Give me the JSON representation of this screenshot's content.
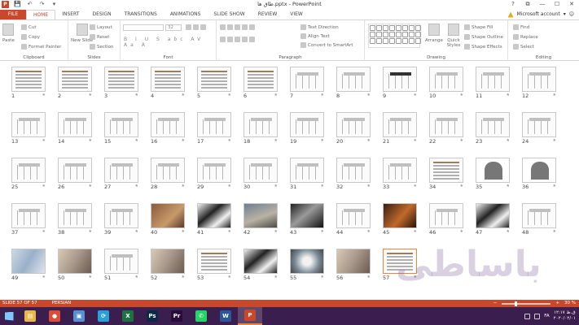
{
  "window": {
    "title": "طاق ها.pptx - PowerPoint",
    "help_glyph": "?",
    "controls": [
      "⧉",
      "—",
      "☐",
      "✕"
    ]
  },
  "qat": {
    "app_letter": "P",
    "save": "💾",
    "undo": "↶",
    "redo": "↷",
    "customize": "▾"
  },
  "tabs": [
    "FILE",
    "HOME",
    "INSERT",
    "DESIGN",
    "TRANSITIONS",
    "ANIMATIONS",
    "SLIDE SHOW",
    "REVIEW",
    "VIEW"
  ],
  "active_tab": "HOME",
  "account": {
    "label": "Microsoft account",
    "caret": "▾",
    "smiley": "☺"
  },
  "ribbon": {
    "clipboard": {
      "label": "Clipboard",
      "paste": "Paste",
      "cut": "Cut",
      "copy": "Copy",
      "format_painter": "Format Painter"
    },
    "slides": {
      "label": "Slides",
      "new_slide": "New Slide",
      "layout": "Layout",
      "reset": "Reset",
      "section": "Section"
    },
    "font": {
      "label": "Font",
      "size": "32",
      "formats": "B I U S abc AV Aa A"
    },
    "paragraph": {
      "label": "Paragraph",
      "text_direction": "Text Direction",
      "align_text": "Align Text",
      "smartart": "Convert to SmartArt"
    },
    "drawing": {
      "label": "Drawing",
      "arrange": "Arrange",
      "quick_styles": "Quick Styles",
      "shape_fill": "Shape Fill",
      "shape_outline": "Shape Outline",
      "shape_effects": "Shape Effects"
    },
    "editing": {
      "label": "Editing",
      "find": "Find",
      "replace": "Replace",
      "select": "Select"
    }
  },
  "slides": [
    {
      "n": "1",
      "kind": "text"
    },
    {
      "n": "2",
      "kind": "text"
    },
    {
      "n": "3",
      "kind": "text"
    },
    {
      "n": "4",
      "kind": "text"
    },
    {
      "n": "5",
      "kind": "text"
    },
    {
      "n": "6",
      "kind": "text"
    },
    {
      "n": "7",
      "kind": "drawing"
    },
    {
      "n": "8",
      "kind": "drawing"
    },
    {
      "n": "9",
      "kind": "drawing-dark"
    },
    {
      "n": "10",
      "kind": "drawing"
    },
    {
      "n": "11",
      "kind": "drawing"
    },
    {
      "n": "12",
      "kind": "drawing"
    },
    {
      "n": "13",
      "kind": "drawing"
    },
    {
      "n": "14",
      "kind": "drawing"
    },
    {
      "n": "15",
      "kind": "drawing"
    },
    {
      "n": "16",
      "kind": "drawing"
    },
    {
      "n": "17",
      "kind": "drawing"
    },
    {
      "n": "18",
      "kind": "drawing"
    },
    {
      "n": "19",
      "kind": "drawing"
    },
    {
      "n": "20",
      "kind": "drawing"
    },
    {
      "n": "21",
      "kind": "drawing"
    },
    {
      "n": "22",
      "kind": "drawing"
    },
    {
      "n": "23",
      "kind": "drawing"
    },
    {
      "n": "24",
      "kind": "drawing"
    },
    {
      "n": "25",
      "kind": "drawing"
    },
    {
      "n": "26",
      "kind": "drawing"
    },
    {
      "n": "27",
      "kind": "drawing"
    },
    {
      "n": "28",
      "kind": "drawing"
    },
    {
      "n": "29",
      "kind": "drawing"
    },
    {
      "n": "30",
      "kind": "drawing"
    },
    {
      "n": "31",
      "kind": "drawing"
    },
    {
      "n": "32",
      "kind": "drawing"
    },
    {
      "n": "33",
      "kind": "drawing"
    },
    {
      "n": "34",
      "kind": "text"
    },
    {
      "n": "35",
      "kind": "shape3d"
    },
    {
      "n": "36",
      "kind": "shape3d"
    },
    {
      "n": "37",
      "kind": "drawing"
    },
    {
      "n": "38",
      "kind": "drawing"
    },
    {
      "n": "39",
      "kind": "drawing"
    },
    {
      "n": "40",
      "kind": "photo-a"
    },
    {
      "n": "41",
      "kind": "photo-f"
    },
    {
      "n": "42",
      "kind": "photo-b"
    },
    {
      "n": "43",
      "kind": "photo-d"
    },
    {
      "n": "44",
      "kind": "drawing"
    },
    {
      "n": "45",
      "kind": "photo-e"
    },
    {
      "n": "46",
      "kind": "drawing"
    },
    {
      "n": "47",
      "kind": "photo-f"
    },
    {
      "n": "48",
      "kind": "drawing"
    },
    {
      "n": "49",
      "kind": "photo-h"
    },
    {
      "n": "50",
      "kind": "photo-c"
    },
    {
      "n": "51",
      "kind": "drawing"
    },
    {
      "n": "52",
      "kind": "photo-c"
    },
    {
      "n": "53",
      "kind": "text"
    },
    {
      "n": "54",
      "kind": "photo-f"
    },
    {
      "n": "55",
      "kind": "photo-g"
    },
    {
      "n": "56",
      "kind": "photo-c"
    },
    {
      "n": "57",
      "kind": "text"
    }
  ],
  "selected_slide": "57",
  "watermark": "باساطی",
  "status": {
    "slide_info": "SLIDE 57 OF 57",
    "language": "PERSIAN",
    "zoom": "30 %",
    "minus": "−",
    "plus": "+"
  },
  "taskbar": {
    "apps": [
      {
        "name": "explorer",
        "glyph": "▤",
        "color": "#e8b84a"
      },
      {
        "name": "chrome",
        "glyph": "●",
        "color": "#dd4b39"
      },
      {
        "name": "computer",
        "glyph": "▣",
        "color": "#5a8fd0"
      },
      {
        "name": "sync",
        "glyph": "⟳",
        "color": "#2a9fd8"
      },
      {
        "name": "excel",
        "glyph": "X",
        "color": "#1e7145"
      },
      {
        "name": "photoshop",
        "glyph": "Ps",
        "color": "#0b2a4a"
      },
      {
        "name": "premiere",
        "glyph": "Pr",
        "color": "#2a0b3a"
      },
      {
        "name": "whatsapp",
        "glyph": "✆",
        "color": "#25d366"
      },
      {
        "name": "word",
        "glyph": "W",
        "color": "#2b579a"
      },
      {
        "name": "powerpoint",
        "glyph": "P",
        "color": "#c9472b"
      }
    ],
    "active_app": "powerpoint",
    "tray": {
      "lang": "FA",
      "time": "۱۲:۱۷ ق.ظ",
      "date": "۲۰۲۰/۰۲/۰۱"
    }
  }
}
